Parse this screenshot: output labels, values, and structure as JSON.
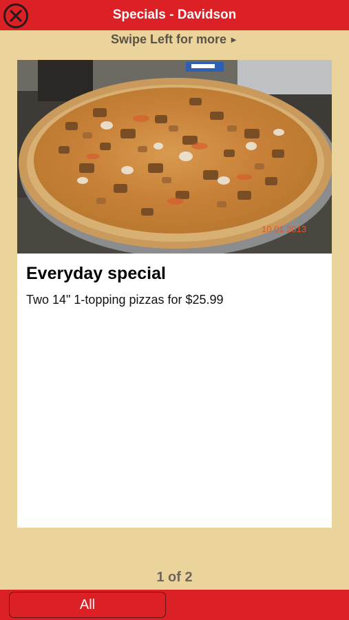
{
  "header": {
    "title": "Specials - Davidson",
    "close_icon": "close-circle-icon"
  },
  "swipe_hint": {
    "text": "Swipe Left for more",
    "arrow_icon": "triangle-right-icon",
    "arrow_glyph": "►"
  },
  "special": {
    "photo_date_stamp": "10 01 2013",
    "title": "Everyday special",
    "description": "Two 14\" 1-topping pizzas for $25.99"
  },
  "pager": {
    "label": "1 of 2"
  },
  "footer": {
    "all_button_label": "All"
  },
  "colors": {
    "bar_red": "#dc2126",
    "background_tan": "#ebd39c",
    "card_white": "#ffffff",
    "close_icon_dark": "#2a1a1a"
  }
}
